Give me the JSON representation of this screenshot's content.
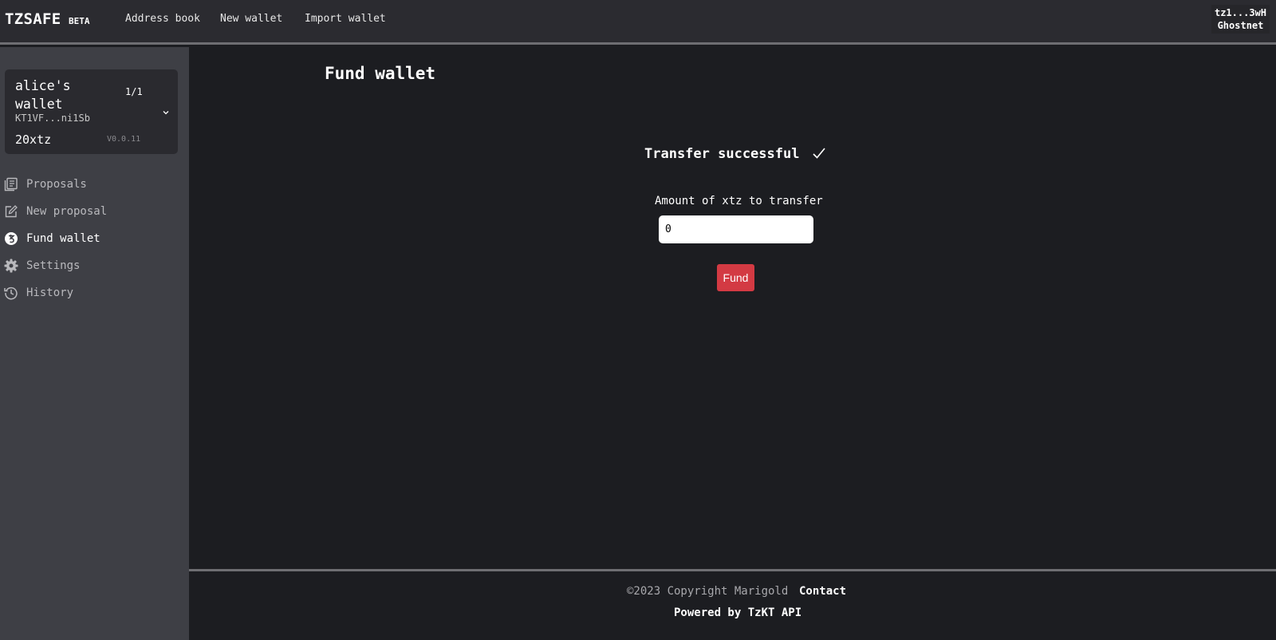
{
  "header": {
    "brand": "TZSAFE",
    "badge": "BETA",
    "nav": [
      "Address book",
      "New wallet",
      "Import wallet"
    ],
    "account": {
      "address": "tz1...3wH",
      "network": "Ghostnet"
    }
  },
  "sidebar": {
    "wallet": {
      "name": "alice's wallet",
      "threshold": "1/1",
      "address": "KT1VF...ni1Sb",
      "balance": "20xtz",
      "version": "V0.0.11"
    },
    "items": [
      {
        "label": "Proposals",
        "icon": "proposals-icon",
        "active": false
      },
      {
        "label": "New proposal",
        "icon": "edit-icon",
        "active": false
      },
      {
        "label": "Fund wallet",
        "icon": "tezos-coin-icon",
        "active": true
      },
      {
        "label": "Settings",
        "icon": "gear-icon",
        "active": false
      },
      {
        "label": "History",
        "icon": "history-icon",
        "active": false
      }
    ]
  },
  "main": {
    "title": "Fund wallet",
    "status": "Transfer successful",
    "amount_label": "Amount of xtz to transfer",
    "amount_value": "0",
    "fund_label": "Fund"
  },
  "footer": {
    "copyright": "©2023 Copyright Marigold",
    "contact": "Contact",
    "powered": "Powered by TzKT API"
  },
  "colors": {
    "topbar": "#2b2b30",
    "sidebar": "#3e3f45",
    "main_bg": "#1c1d21",
    "accent": "#d33a43"
  }
}
